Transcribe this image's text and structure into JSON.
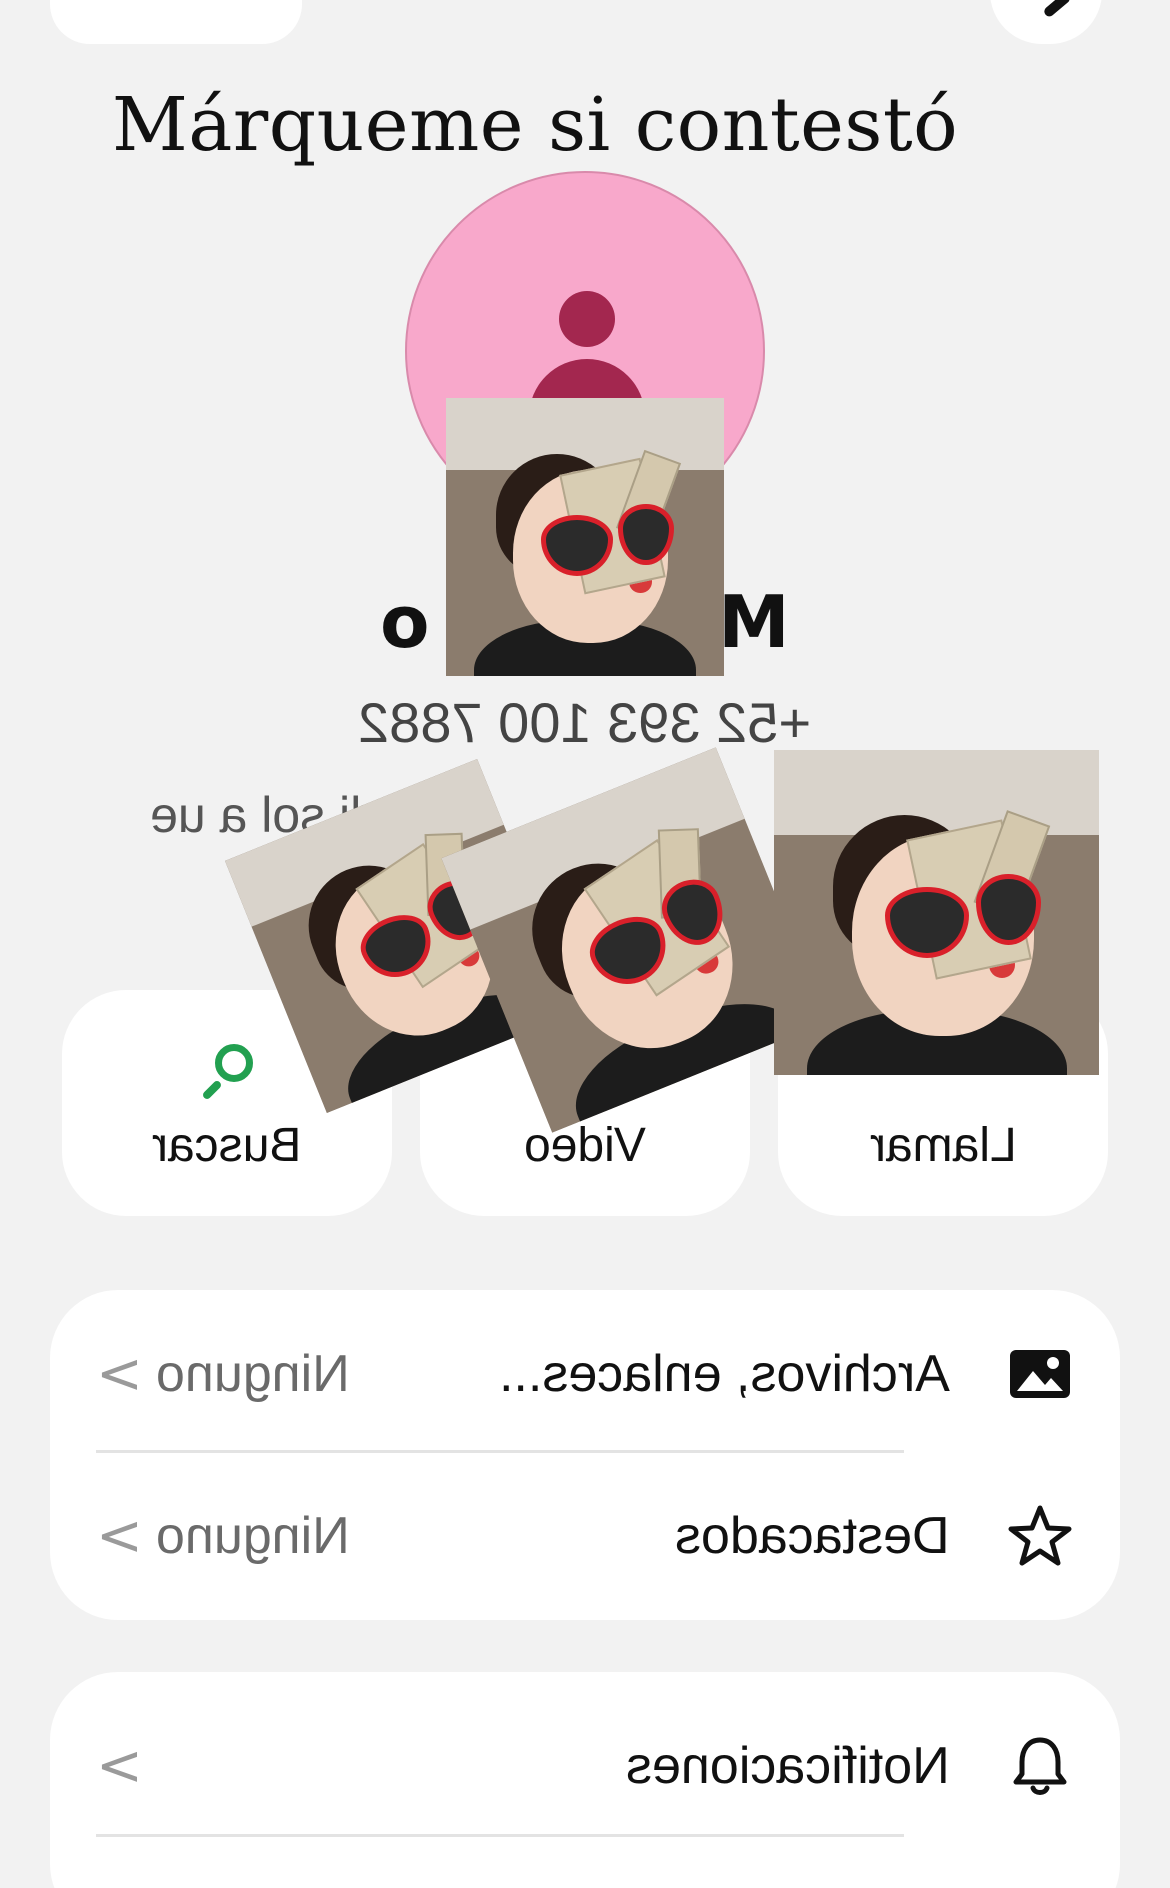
{
  "overlay": {
    "caption": "Márqueme si contestó"
  },
  "contact": {
    "name_left_fragment": "o",
    "name_right_fragment": "M",
    "phone": "+52 393 100 7882",
    "status_fragment": "adi sol a                ue"
  },
  "actions": [
    {
      "label": "Buscar",
      "icon": "search-icon",
      "color": "#22a050"
    },
    {
      "label": "Video",
      "icon": "video-icon"
    },
    {
      "label": "Llamar",
      "icon": "phone-icon"
    }
  ],
  "settings": {
    "media": {
      "title": "Archivos, enlaces...",
      "value": "Ninguno",
      "icon": "image-icon"
    },
    "starred": {
      "title": "Destacados",
      "value": "Ninguno",
      "icon": "star-icon"
    },
    "notifications": {
      "title": "Notificaciones",
      "icon": "bell-icon"
    }
  },
  "chevron": "<",
  "colors": {
    "background": "#f2f2f2",
    "avatar_bg": "#f8a8cb",
    "avatar_fg": "#a3274f",
    "accent_green": "#22a050"
  }
}
